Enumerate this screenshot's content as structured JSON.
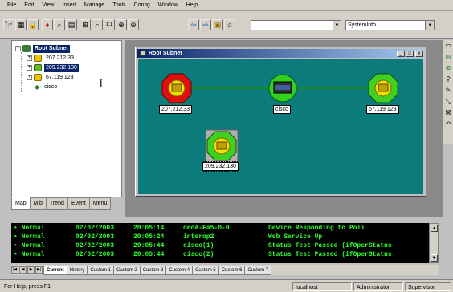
{
  "menu": [
    "File",
    "Edit",
    "View",
    "Insert",
    "Manage",
    "Tools",
    "Config",
    "Window",
    "Help"
  ],
  "toolbar": {
    "icons": [
      "find-icon",
      "grid-icon",
      "lock-icon",
      "alert-icon",
      "find-device-icon",
      "select-icon",
      "zoom-fit-icon",
      "search-icon",
      "zoom-actual-icon",
      "zoom-in-icon",
      "zoom-out-icon",
      "back-icon",
      "forward-icon",
      "map-icon",
      "home-icon"
    ],
    "icon_glyphs": [
      "🔭",
      "▦",
      "🔒",
      "♦",
      "⌕",
      "▤",
      "⊞",
      "⌕",
      "1:1",
      "⊕",
      "⊖",
      "⇦",
      "⇨",
      "▣",
      "⌂"
    ],
    "combo1_value": "",
    "combo2_value": "SystemInfo"
  },
  "tree": {
    "root": "Root Subnet",
    "items": [
      {
        "label": "207.212.33",
        "icon_color": "#e8c800"
      },
      {
        "label": "209.232.130",
        "icon_color": "#60c020",
        "selected": true
      },
      {
        "label": "67.119.123",
        "icon_color": "#e8c800"
      },
      {
        "label": "cisco",
        "icon_color": "#208020"
      }
    ]
  },
  "left_tabs": [
    "Map",
    "Mib",
    "Trend",
    "Event",
    "Menu"
  ],
  "map_window": {
    "title": "Root Subnet",
    "min": "_",
    "max": "□",
    "close": "x",
    "nodes": [
      {
        "label": "207.212.33",
        "status": "red"
      },
      {
        "label": "cisco",
        "status": "green"
      },
      {
        "label": "67.119.123",
        "status": "green"
      },
      {
        "label": "209.232.130",
        "status": "green"
      }
    ],
    "canvas_color": "#0b7b7b"
  },
  "right_toolbar": [
    "pointer-icon",
    "refresh-icon",
    "link-icon",
    "wand-icon",
    "pen-icon",
    "move-icon",
    "tree-icon",
    "undo-icon"
  ],
  "right_glyphs": [
    "▭",
    "◎",
    "⊘",
    "⚲",
    "✎",
    "⤡",
    "⌘",
    "↶"
  ],
  "events": [
    {
      "severity": "Normal",
      "date": "02/02/2003",
      "time": "20:05:14",
      "source": "dedA-Fa5-0-0",
      "message": "Device Responding to Poll"
    },
    {
      "severity": "Normal",
      "date": "02/02/2003",
      "time": "20:05:24",
      "source": "interop2",
      "message": "Web Service Up"
    },
    {
      "severity": "Normal",
      "date": "02/02/2003",
      "time": "20:05:44",
      "source": "cisco(1)",
      "message": "Status Test Passed (ifOperStatus"
    },
    {
      "severity": "Normal",
      "date": "02/02/2003",
      "time": "20:05:44",
      "source": "cisco(2)",
      "message": "Status Test Passed (ifOperStatus"
    }
  ],
  "console_tabs": [
    "Current",
    "History",
    "Custom 1",
    "Custom 2",
    "Custom 3",
    "Custom 4",
    "Custom 5",
    "Custom 6",
    "Custom 7"
  ],
  "status": {
    "help": "For Help, press F1",
    "host": "localhost",
    "user": "Administrator",
    "role": "Supervisor"
  }
}
